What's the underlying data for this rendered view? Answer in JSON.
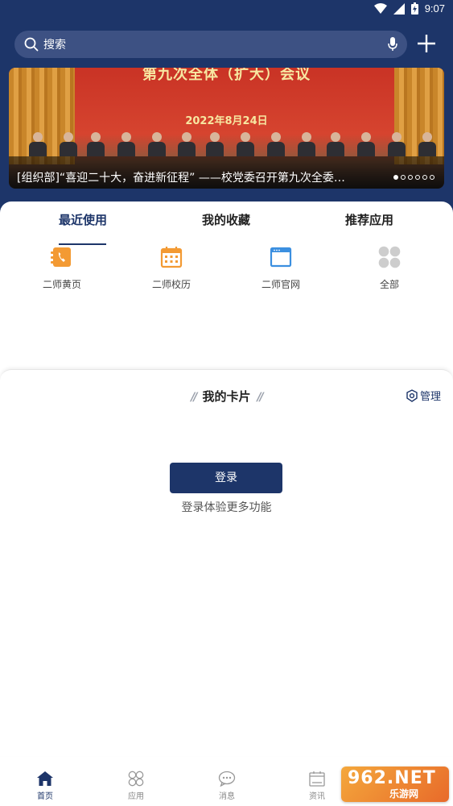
{
  "status_bar": {
    "time": "9:07"
  },
  "search": {
    "placeholder": "搜索"
  },
  "banner": {
    "title_text": "第九次全体（扩大）会议",
    "date_text": "2022年8月24日",
    "caption": "[组织部]“喜迎二十大，奋进新征程” ——校党委召开第九次全委…",
    "total_slides": 6,
    "active_slide": 1
  },
  "tabs": [
    {
      "label": "最近使用",
      "active": true
    },
    {
      "label": "我的收藏",
      "active": false
    },
    {
      "label": "推荐应用",
      "active": false
    }
  ],
  "apps": [
    {
      "label": "二师黄页",
      "icon": "phonebook-icon",
      "color": "#f39a33"
    },
    {
      "label": "二师校历",
      "icon": "calendar-icon",
      "color": "#f39a33"
    },
    {
      "label": "二师官网",
      "icon": "browser-window-icon",
      "color": "#3b8fe0"
    },
    {
      "label": "全部",
      "icon": "grid-icon",
      "color": "#c8c8c8"
    }
  ],
  "card_section": {
    "title": "我的卡片",
    "manage_label": "管理",
    "login_label": "登录",
    "login_hint": "登录体验更多功能"
  },
  "bottom_nav": [
    {
      "label": "首页",
      "icon": "home-icon",
      "active": true
    },
    {
      "label": "应用",
      "icon": "apps-icon",
      "active": false
    },
    {
      "label": "消息",
      "icon": "message-icon",
      "active": false
    },
    {
      "label": "资讯",
      "icon": "news-icon",
      "active": false
    }
  ],
  "watermark": {
    "brand": "962.NET",
    "subtitle": "乐游网"
  },
  "colors": {
    "primary": "#1d3569",
    "accent_orange": "#f39a33",
    "accent_blue": "#3b8fe0"
  }
}
